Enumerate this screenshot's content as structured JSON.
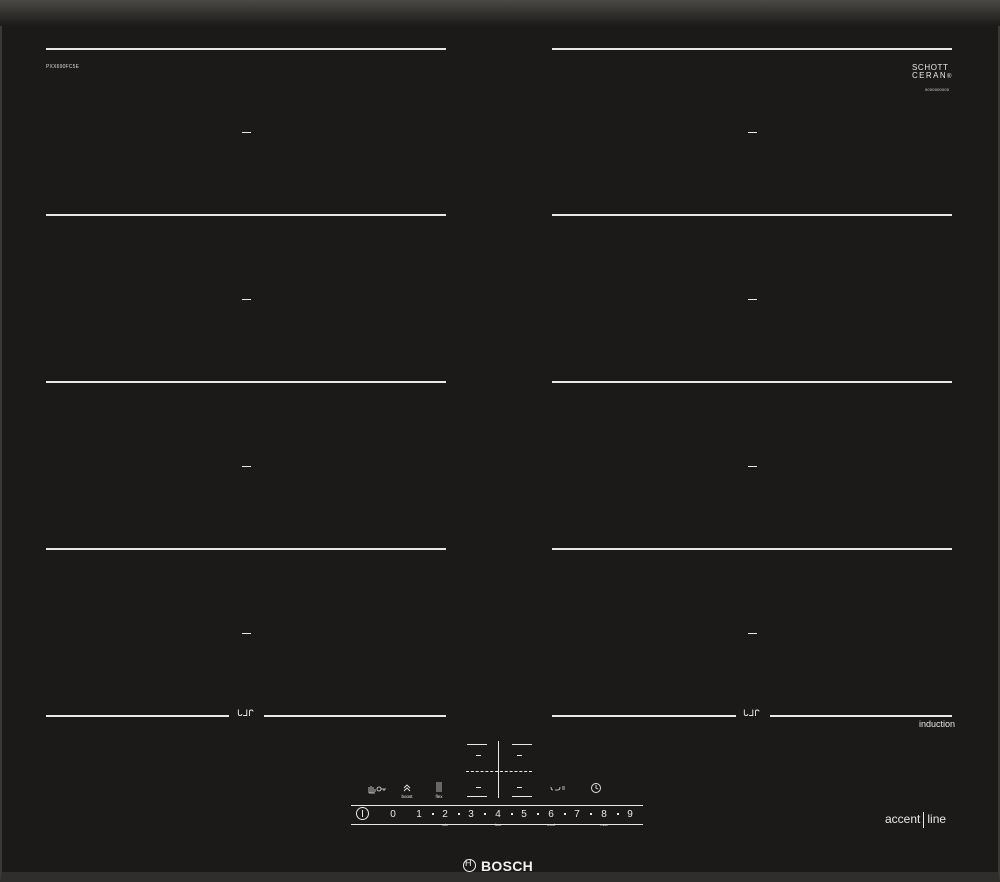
{
  "model": {
    "code": "PXX690FC5E",
    "serial": "0000000000"
  },
  "glass_brand": {
    "line1": "SCHOTT",
    "line2": "CERAN",
    "mark": "®"
  },
  "cooking_zones": {
    "left": [
      {
        "display": "–"
      },
      {
        "display": "–"
      },
      {
        "display": "–"
      },
      {
        "display": "–"
      }
    ],
    "right": [
      {
        "display": "–"
      },
      {
        "display": "–"
      },
      {
        "display": "–"
      },
      {
        "display": "–"
      }
    ]
  },
  "flex_bridge_symbol": "ᒐᒧᒋ",
  "induction_label": "induction",
  "series": {
    "part1": "accent",
    "part2": "line"
  },
  "functions": {
    "childlock_icon": "childlock-icon",
    "boost": {
      "icon": "boost-icon",
      "label": "boost"
    },
    "flex": {
      "icon": "flex-icon",
      "label": "flex"
    },
    "move_icon": "move-icon",
    "timer_icon": "timer-icon"
  },
  "center_display": {
    "top_left": "–",
    "top_right": "–",
    "mid_left": "–",
    "mid_right": "–"
  },
  "power_slider": {
    "power_icon": "power-icon",
    "levels": [
      "0",
      "1",
      "2",
      "3",
      "4",
      "5",
      "6",
      "7",
      "8",
      "9"
    ],
    "sublabels": {
      "low": "min",
      "low2": "low",
      "med": "med",
      "high": "max"
    }
  },
  "brand": "BOSCH"
}
